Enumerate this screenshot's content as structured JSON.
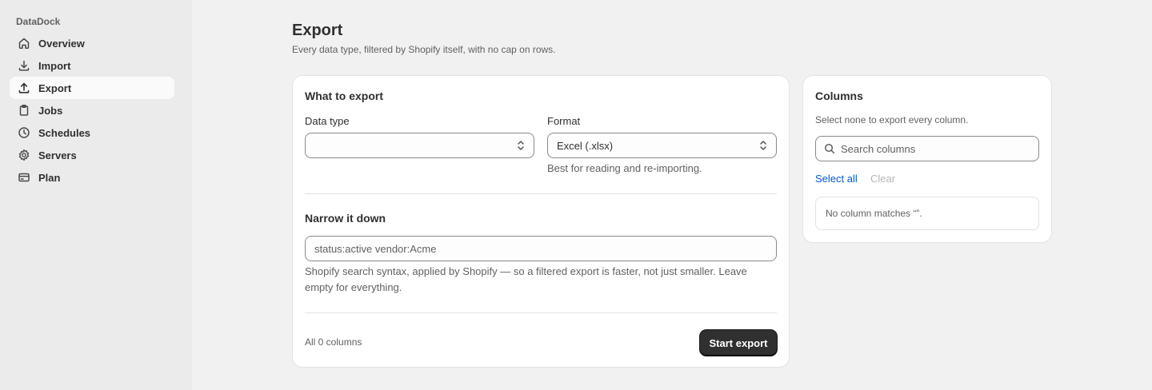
{
  "app": {
    "name": "DataDock"
  },
  "sidebar": {
    "items": [
      {
        "label": "Overview",
        "icon": "home-icon"
      },
      {
        "label": "Import",
        "icon": "download-icon"
      },
      {
        "label": "Export",
        "icon": "upload-icon",
        "active": true
      },
      {
        "label": "Jobs",
        "icon": "clipboard-icon"
      },
      {
        "label": "Schedules",
        "icon": "clock-icon"
      },
      {
        "label": "Servers",
        "icon": "gear-icon"
      },
      {
        "label": "Plan",
        "icon": "credit-card-icon"
      }
    ]
  },
  "page": {
    "title": "Export",
    "subtitle": "Every data type, filtered by Shopify itself, with no cap on rows."
  },
  "export_card": {
    "title": "What to export",
    "data_type": {
      "label": "Data type",
      "value": ""
    },
    "format": {
      "label": "Format",
      "value": "Excel (.xlsx)",
      "help": "Best for reading and re-importing."
    },
    "narrow": {
      "title": "Narrow it down",
      "placeholder": "status:active vendor:Acme",
      "help": "Shopify search syntax, applied by Shopify — so a filtered export is faster, not just smaller. Leave empty for everything."
    },
    "footer": {
      "columns_summary": "All 0 columns",
      "start_label": "Start export"
    }
  },
  "columns_card": {
    "title": "Columns",
    "help": "Select none to export every column.",
    "search_placeholder": "Search columns",
    "select_all_label": "Select all",
    "clear_label": "Clear",
    "empty_text": "No column matches “”."
  },
  "colors": {
    "accent": "#005bd3",
    "primary_button": "#303030",
    "page_bg": "#f1f1f1",
    "sidebar_bg": "#ebebeb"
  }
}
